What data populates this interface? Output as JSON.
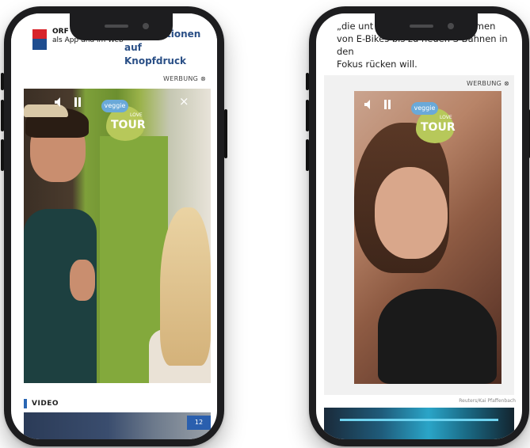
{
  "left_phone": {
    "orf_text_line1": "ORF",
    "orf_text_line2": "als App und im Web",
    "headline_line1": "Informationen auf",
    "headline_line2": "Knopfdruck",
    "ad_label": "WERBUNG ⊗",
    "close_icon": "×",
    "badge_veggie": "veggie",
    "badge_love": "LOVE",
    "badge_tour": "TOUR",
    "video_label": "VIDEO",
    "sign_text": "12"
  },
  "right_phone": {
    "article_line1": "„die unt                                ormen",
    "article_line2": "von E-Bikes bis zu neuen S-Bahnen in den",
    "article_line3": "Fokus rücken will.",
    "ad_label": "WERBUNG ⊗",
    "badge_veggie": "veggie",
    "badge_love": "LOVE",
    "badge_tour": "TOUR",
    "credit": "Reuters/Kai Pfaffenbach"
  }
}
